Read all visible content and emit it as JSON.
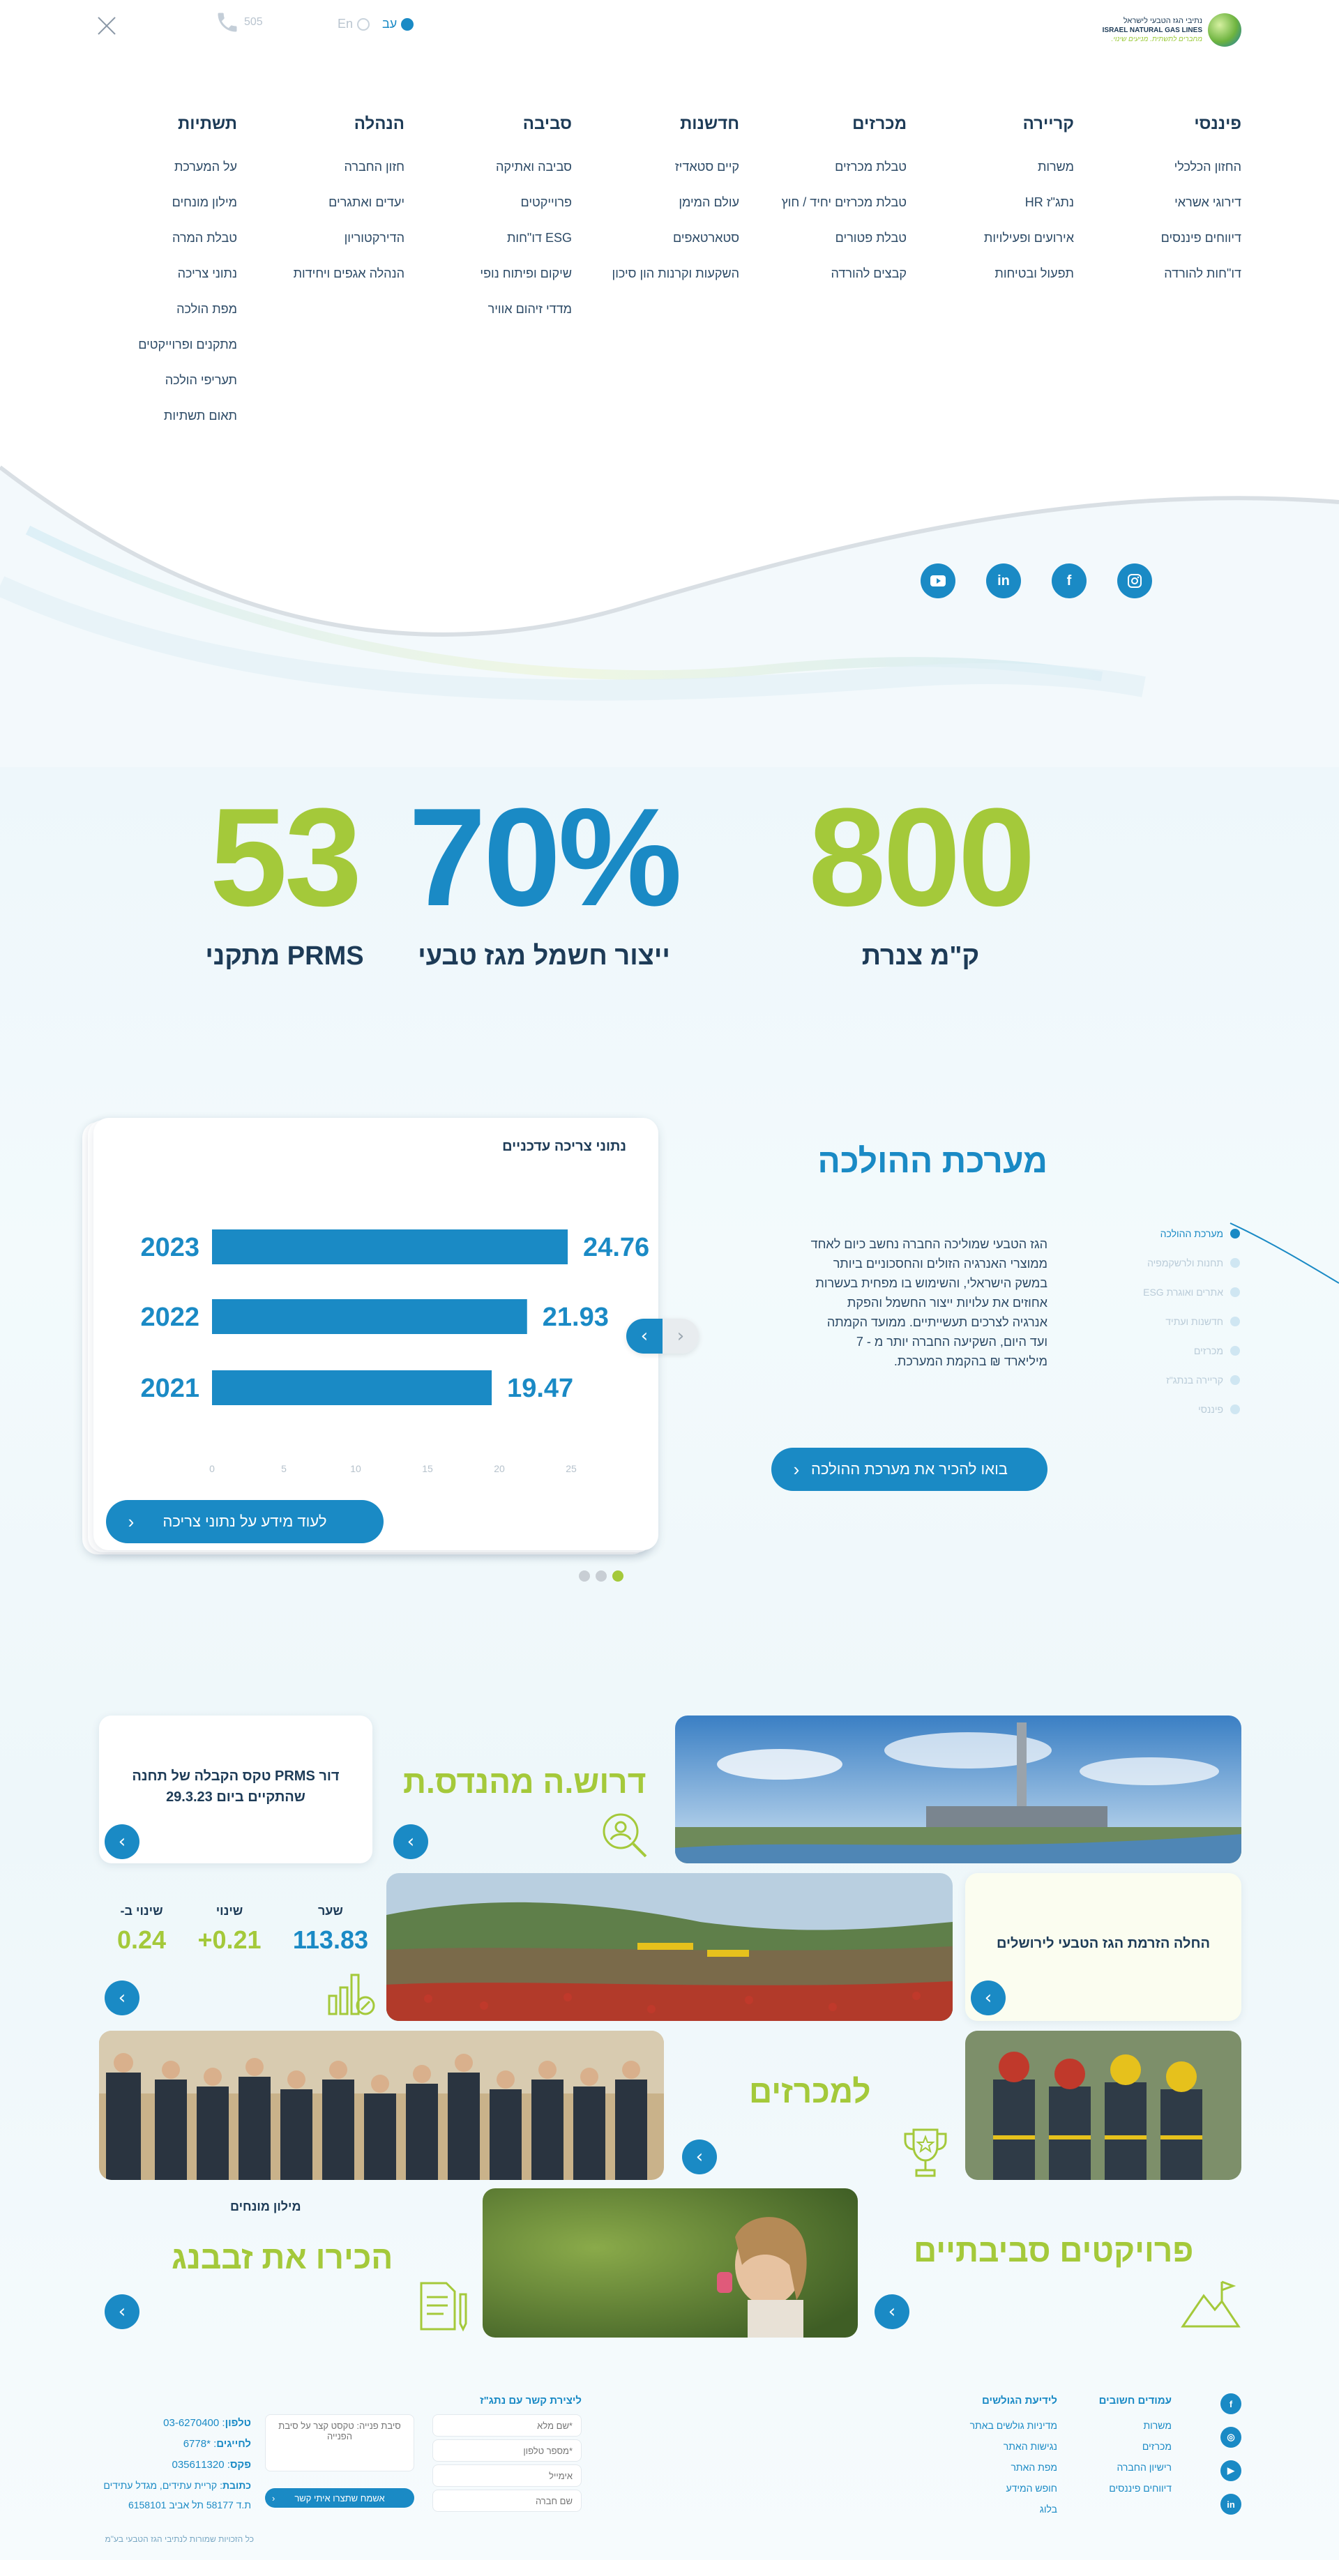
{
  "header": {
    "phone_label": "505",
    "lang_he": "עב",
    "lang_en": "En",
    "logo_he": "נתיבי הגז הטבעי לישראל",
    "logo_en": "ISRAEL NATURAL GAS LINES",
    "logo_slogan": "מחברים לתשתית. מניעים שינוי."
  },
  "menu": [
    {
      "title": "תשתיות",
      "items": [
        "על המערכת",
        "מילון מונחים",
        "טבלת המרה",
        "נתוני צריכה",
        "מפת הולכה",
        "מתקנים ופרוייקטים",
        "תעריפי הולכה",
        "תאום תשתיות"
      ]
    },
    {
      "title": "הנהלה",
      "items": [
        "חזון החברה",
        "יעדים ואתגרים",
        "הדירקטוריון",
        "הנהלה אגפים ויחידות"
      ]
    },
    {
      "title": "סביבה",
      "items": [
        "סביבה ואתיקה",
        "פרוייקטים",
        "ESG דו\"חות",
        "שיקום ופיתוח נופי",
        "מדדי זיהום אוויר"
      ]
    },
    {
      "title": "חדשנות",
      "items": [
        "קיים סטאדיז",
        "עולם המימן",
        "סטארטאפים",
        "השקעות וקרנות הון סיכון"
      ]
    },
    {
      "title": "מכרזים",
      "items": [
        "טבלת מכרזים",
        "טבלת מכרזים יחיד / חוץ",
        "טבלת פטורים",
        "קבצים להורדה"
      ]
    },
    {
      "title": "קריירה",
      "items": [
        "משרות",
        "נתג\"ז HR",
        "אירועים ופעילויות",
        "תפעול ובטיחות"
      ]
    },
    {
      "title": "פיננסי",
      "items": [
        "החזון הכלכלי",
        "דירוגי אשראי",
        "דיווחים פיננסים",
        "דו\"חות להורדה"
      ]
    }
  ],
  "socials": [
    "instagram-icon",
    "facebook-icon",
    "linkedin-icon",
    "youtube-icon"
  ],
  "stats": [
    {
      "value": "800",
      "label": "ק\"מ צנרת",
      "color": "#a4c93a"
    },
    {
      "value": "70%",
      "label": "ייצור חשמל מגז טבעי",
      "color": "#1a8ac5"
    },
    {
      "value": "53",
      "label": "מתקני PRMS",
      "color": "#a4c93a"
    }
  ],
  "consumption": {
    "card_title": "נתוני צריכה עדכניים",
    "button": "לעוד מידע על נתוני צריכה"
  },
  "chart_data": {
    "type": "bar",
    "orientation": "horizontal",
    "title": "נתוני צריכה עדכניים",
    "categories": [
      "2023",
      "2022",
      "2021"
    ],
    "values": [
      24.76,
      21.93,
      19.47
    ],
    "xlim": [
      0,
      25
    ],
    "xticks": [
      0,
      5,
      10,
      15,
      20,
      25
    ],
    "bar_color": "#1a8ac5"
  },
  "system": {
    "title": "מערכת ההולכה",
    "text": "הגז הטבעי שמוליכה החברה נחשב כיום לאחד ממוצרי האנרגיה הזולים והחסכוניים ביותר במשק הישראלי, והשימוש בו מפחית בעשרות אחוזים את עלויות ייצור החשמל והפקת אנרגיה לצרכים תעשייתיים. ממועד הקמתה ועד היום, השקיעה החברה יותר מ - 7 מיליארד ₪ בהקמת המערכת.",
    "button": "בואו להכיר את מערכת ההולכה",
    "side_nav": [
      "מערכת ההולכה",
      "תחנות ולרשקמפיה",
      "אתרים ואוגרת ESG",
      "חדשנות ועתיד",
      "מכרזים",
      "קריירה בנתג\"ז",
      "פיננסי"
    ]
  },
  "tiles": {
    "engineer": "דרוש.ה מהנדס.ת",
    "prms_notice": "דור PRMS טקס הקבלה של תחנה שהתקיים ביום 29.3.23",
    "jerusalem": "החלה הזרמת הגז הטבעי לירושלים",
    "share": {
      "rate_label": "שער",
      "rate": "113.83",
      "change_label": "שינוי",
      "change": "+0.21",
      "pct_label": "שינוי ב-",
      "pct": "0.24"
    },
    "tenders": "למכרזים",
    "glossary_label": "מילון מונחים",
    "zavbang": "הכירו את זבבנג",
    "env_projects": "פרויקטים סביבתיים"
  },
  "footer": {
    "important_title": "עמודים חשובים",
    "important": [
      "משרות",
      "מכרזים",
      "רישיון החברה",
      "דיווחים פיננסים"
    ],
    "stakeholders_title": "לידיעת הגולשים",
    "stakeholders": [
      "מדיניות גולשים באתר",
      "נגישות האתר",
      "מפת האתר",
      "חופש המידע",
      "בלוג"
    ],
    "contact_title": "ליצירת קשר עם נתג\"ז",
    "fields": [
      "*שם מלא",
      "*מספר טלפון",
      "אימייל",
      "שם חברה"
    ],
    "message_placeholder": "סיבת פנייה: טקסט קצר על סיבת הפנייה",
    "submit": "אשמח שתצרו איתי קשר",
    "phone_label": "טלפון",
    "phone": "03-6270400",
    "hotline_label": "לחייגים",
    "hotline": "*6778",
    "fax_label": "פקס",
    "fax": "035611320",
    "address_label": "כתובת",
    "address": "קריית עתידים, מגדל עתידים",
    "pobox": "ת.ד 58177 תל אביב 6158101",
    "copyright": "כל הזכויות שמורות לנתיבי הגז הטבעי בע\"מ"
  }
}
